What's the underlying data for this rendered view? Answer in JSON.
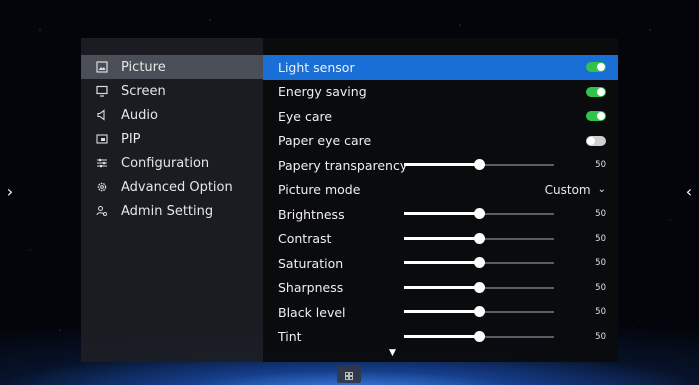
{
  "sidebar": {
    "items": [
      {
        "label": "Picture",
        "icon": "picture-icon",
        "selected": true
      },
      {
        "label": "Screen",
        "icon": "monitor-icon",
        "selected": false
      },
      {
        "label": "Audio",
        "icon": "speaker-icon",
        "selected": false
      },
      {
        "label": "PIP",
        "icon": "pip-icon",
        "selected": false
      },
      {
        "label": "Configuration",
        "icon": "sliders-icon",
        "selected": false
      },
      {
        "label": "Advanced Option",
        "icon": "gear-icon",
        "selected": false
      },
      {
        "label": "Admin Setting",
        "icon": "admin-icon",
        "selected": false
      }
    ]
  },
  "settings": {
    "light_sensor": {
      "label": "Light sensor",
      "state": "on",
      "selected": true
    },
    "energy_saving": {
      "label": "Energy saving",
      "state": "on"
    },
    "eye_care": {
      "label": "Eye care",
      "state": "on"
    },
    "paper_eye_care": {
      "label": "Paper eye care",
      "state": "off"
    },
    "papery_transparency": {
      "label": "Papery transparency",
      "value": "50",
      "level": 0.5
    },
    "picture_mode": {
      "label": "Picture mode",
      "value": "Custom"
    },
    "brightness": {
      "label": "Brightness",
      "value": "50",
      "level": 0.5
    },
    "contrast": {
      "label": "Contrast",
      "value": "50",
      "level": 0.5
    },
    "saturation": {
      "label": "Saturation",
      "value": "50",
      "level": 0.5
    },
    "sharpness": {
      "label": "Sharpness",
      "value": "50",
      "level": 0.5
    },
    "black_level": {
      "label": "Black level",
      "value": "50",
      "level": 0.5
    },
    "tint": {
      "label": "Tint",
      "value": "50",
      "level": 0.5
    }
  },
  "colors": {
    "accent": "#1a6fd6",
    "toggle_on": "#30c24a",
    "toggle_off": "#cfcfcf"
  },
  "icons": {
    "left_edge": "chevron-right-icon",
    "right_edge": "chevron-left-icon",
    "scroll_more": "caret-down-icon",
    "home": "grid-icon"
  }
}
